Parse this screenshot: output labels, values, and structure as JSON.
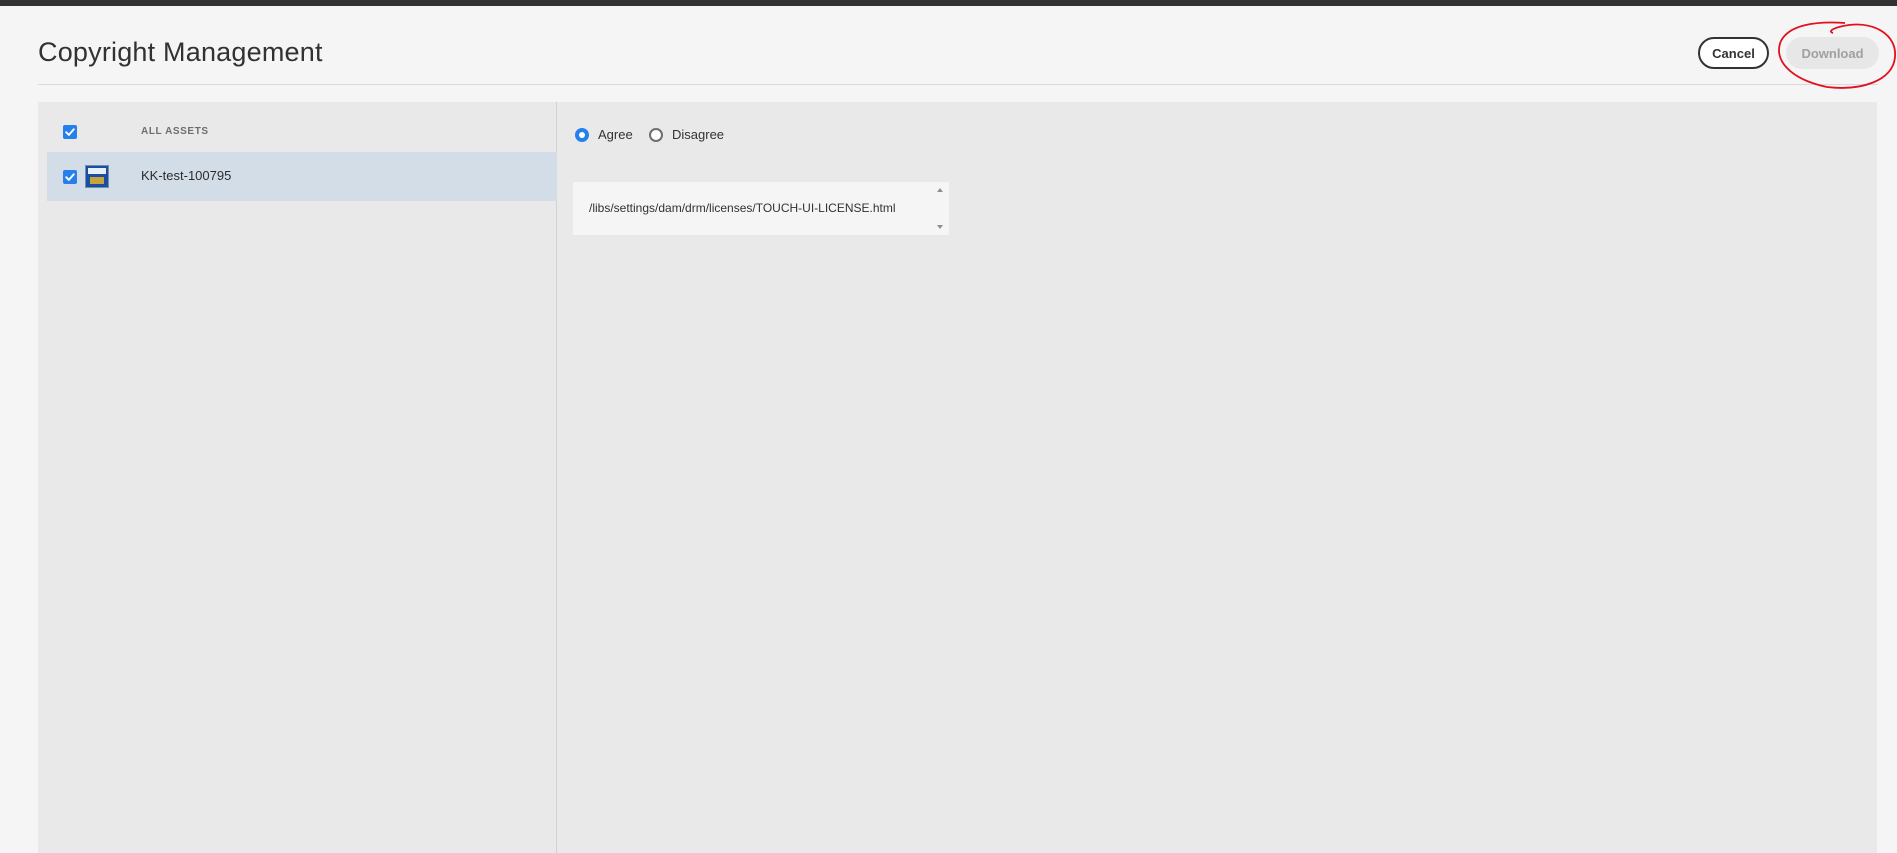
{
  "header": {
    "title": "Copyright Management",
    "cancel_label": "Cancel",
    "download_label": "Download"
  },
  "asset_list": {
    "column_header": "ALL ASSETS",
    "select_all_checked": true,
    "items": [
      {
        "name": "KK-test-100795",
        "checked": true,
        "selected": true,
        "thumbnail_icon": "image-thumbnail-icon"
      }
    ]
  },
  "license": {
    "options": [
      {
        "label": "Agree",
        "checked": true
      },
      {
        "label": "Disagree",
        "checked": false
      }
    ],
    "license_path": "/libs/settings/dam/drm/licenses/TOUCH-UI-LICENSE.html"
  },
  "colors": {
    "accent": "#2680eb",
    "selected_row": "#d3dde8",
    "annotation": "#e0101e",
    "disabled_button": "#e7e7e7"
  }
}
